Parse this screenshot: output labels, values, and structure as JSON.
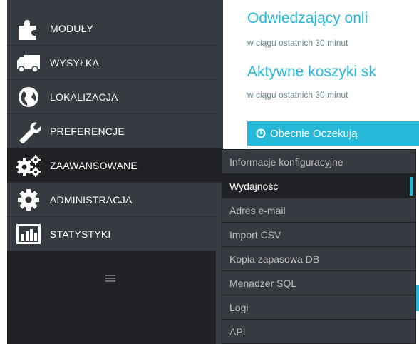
{
  "sidebar": {
    "items": [
      {
        "label": "MODUŁY",
        "icon": "puzzle-icon"
      },
      {
        "label": "WYSYŁKA",
        "icon": "truck-icon"
      },
      {
        "label": "LOKALIZACJA",
        "icon": "globe-icon"
      },
      {
        "label": "PREFERENCJE",
        "icon": "wrench-icon"
      },
      {
        "label": "ZAAWANSOWANE",
        "icon": "cogs-icon"
      },
      {
        "label": "ADMINISTRACJA",
        "icon": "cog-icon"
      },
      {
        "label": "STATYSTYKI",
        "icon": "bar-chart-icon"
      }
    ],
    "collapse_icon": "hamburger-icon"
  },
  "main": {
    "visitors_title": "Odwiedzający onli",
    "visitors_sub": "w ciągu ostatnich 30 minut",
    "carts_title": "Aktywne koszyki sk",
    "carts_sub": "w ciągu ostatnich 30 minut",
    "pending_label": "Obecnie Oczekują"
  },
  "submenu": {
    "items": [
      {
        "label": "Informacje konfiguracyjne"
      },
      {
        "label": "Wydajność"
      },
      {
        "label": "Adres e-mail"
      },
      {
        "label": "Import CSV"
      },
      {
        "label": "Kopia zapasowa DB"
      },
      {
        "label": "Menadżer SQL"
      },
      {
        "label": "Logi"
      },
      {
        "label": "API"
      }
    ]
  },
  "colors": {
    "accent": "#25b9d7",
    "sidebar_bg": "#363a41",
    "sidebar_active_bg": "#202226"
  }
}
